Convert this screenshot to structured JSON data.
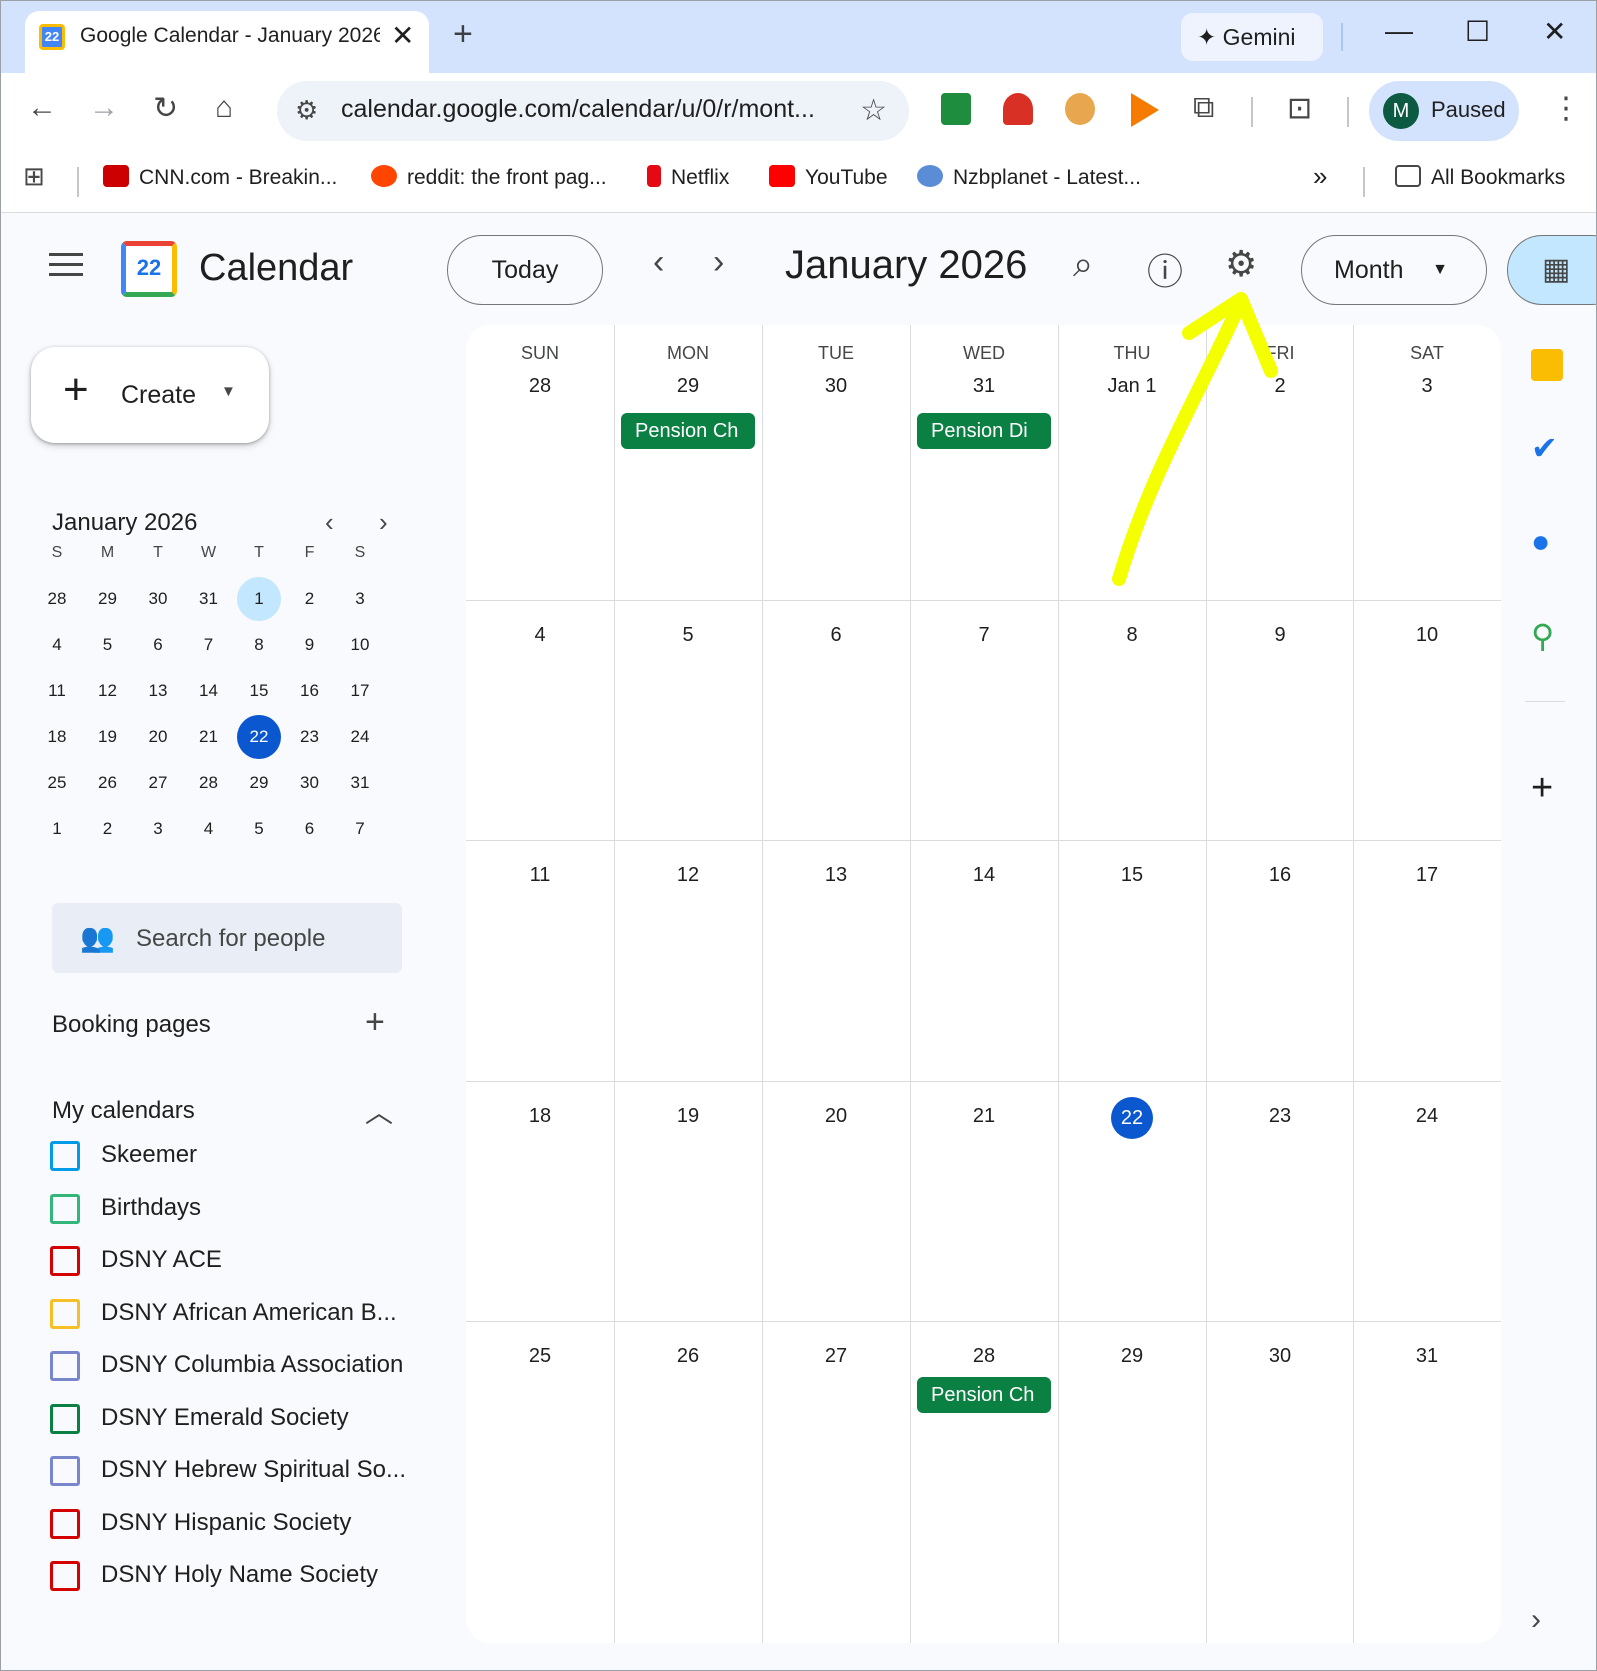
{
  "browser": {
    "tab_title": "Google Calendar - January 2026",
    "tab_close": "✕",
    "new_tab": "+",
    "gemini_label": "Gemini",
    "url": "calendar.google.com/calendar/u/0/r/mont...",
    "profile_initial": "M",
    "profile_status": "Paused",
    "bookmarks": [
      "CNN.com - Breakin...",
      "reddit: the front pag...",
      "Netflix",
      "YouTube",
      "Nzbplanet - Latest..."
    ],
    "all_bookmarks": "All Bookmarks",
    "colors": {
      "tab_strip": "#d3e3fd",
      "profile_avatar": "#0b5a41"
    }
  },
  "header": {
    "app_title": "Calendar",
    "logo_day": "22",
    "today_label": "Today",
    "month_title": "January 2026",
    "view_label": "Month"
  },
  "sidebar": {
    "create_label": "Create",
    "mini_calendar": {
      "title": "January 2026",
      "weekdays": [
        "S",
        "M",
        "T",
        "W",
        "T",
        "F",
        "S"
      ],
      "weeks": [
        [
          "28",
          "29",
          "30",
          "31",
          "1",
          "2",
          "3"
        ],
        [
          "4",
          "5",
          "6",
          "7",
          "8",
          "9",
          "10"
        ],
        [
          "11",
          "12",
          "13",
          "14",
          "15",
          "16",
          "17"
        ],
        [
          "18",
          "19",
          "20",
          "21",
          "22",
          "23",
          "24"
        ],
        [
          "25",
          "26",
          "27",
          "28",
          "29",
          "30",
          "31"
        ],
        [
          "1",
          "2",
          "3",
          "4",
          "5",
          "6",
          "7"
        ]
      ]
    },
    "search_people_placeholder": "Search for people",
    "booking_pages_label": "Booking pages",
    "my_calendars_label": "My calendars",
    "calendars": [
      {
        "name": "Skeemer",
        "color": "#039be5"
      },
      {
        "name": "Birthdays",
        "color": "#33b679"
      },
      {
        "name": "DSNY ACE",
        "color": "#d50000"
      },
      {
        "name": "DSNY African American B...",
        "color": "#f6bf26"
      },
      {
        "name": "DSNY Columbia Association",
        "color": "#7986cb"
      },
      {
        "name": "DSNY Emerald Society",
        "color": "#0b8043"
      },
      {
        "name": "DSNY Hebrew Spiritual So...",
        "color": "#7986cb"
      },
      {
        "name": "DSNY Hispanic Society",
        "color": "#d50000"
      },
      {
        "name": "DSNY Holy Name Society",
        "color": "#d50000"
      }
    ]
  },
  "month_view": {
    "day_headers": [
      "SUN",
      "MON",
      "TUE",
      "WED",
      "THU",
      "FRI",
      "SAT"
    ],
    "weeks": [
      [
        "28",
        "29",
        "30",
        "31",
        "Jan 1",
        "2",
        "3"
      ],
      [
        "4",
        "5",
        "6",
        "7",
        "8",
        "9",
        "10"
      ],
      [
        "11",
        "12",
        "13",
        "14",
        "15",
        "16",
        "17"
      ],
      [
        "18",
        "19",
        "20",
        "21",
        "22",
        "23",
        "24"
      ],
      [
        "25",
        "26",
        "27",
        "28",
        "29",
        "30",
        "31"
      ]
    ],
    "events": [
      {
        "label": "Pension Ch",
        "week": 0,
        "day": 1
      },
      {
        "label": "Pension Di",
        "week": 0,
        "day": 3
      },
      {
        "label": "Pension Ch",
        "week": 4,
        "day": 3
      }
    ],
    "event_color": "#0b8043",
    "today_color": "#0b57d0"
  }
}
